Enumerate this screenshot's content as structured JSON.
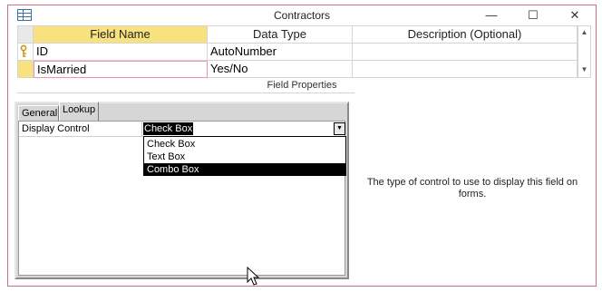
{
  "window": {
    "title": "Contractors"
  },
  "titlebar_buttons": {
    "minimize": "—",
    "maximize": "☐",
    "close": "✕"
  },
  "grid": {
    "columns": [
      "Field Name",
      "Data Type",
      "Description (Optional)"
    ],
    "rows": [
      {
        "field_name": "ID",
        "data_type": "AutoNumber",
        "description": "",
        "is_key": true
      },
      {
        "field_name": "IsMarried",
        "data_type": "Yes/No",
        "description": "",
        "is_key": false
      }
    ],
    "scroll_up": "▲",
    "scroll_down": "▼"
  },
  "field_properties": {
    "label": "Field Properties",
    "tabs": [
      "General",
      "Lookup"
    ],
    "active_tab": "Lookup",
    "property": {
      "label": "Display Control",
      "value": "Check Box",
      "dropdown_arrow": "▼",
      "options": [
        "Check Box",
        "Text Box",
        "Combo Box"
      ],
      "highlighted_option": "Combo Box"
    }
  },
  "help_text": "The type of control to use to display this field on forms.",
  "colors": {
    "header_yellow": "#f8e27f",
    "selected_cell_border": "#e89aa0",
    "window_border": "#c8737b",
    "key_icon": "#c79a1b"
  }
}
